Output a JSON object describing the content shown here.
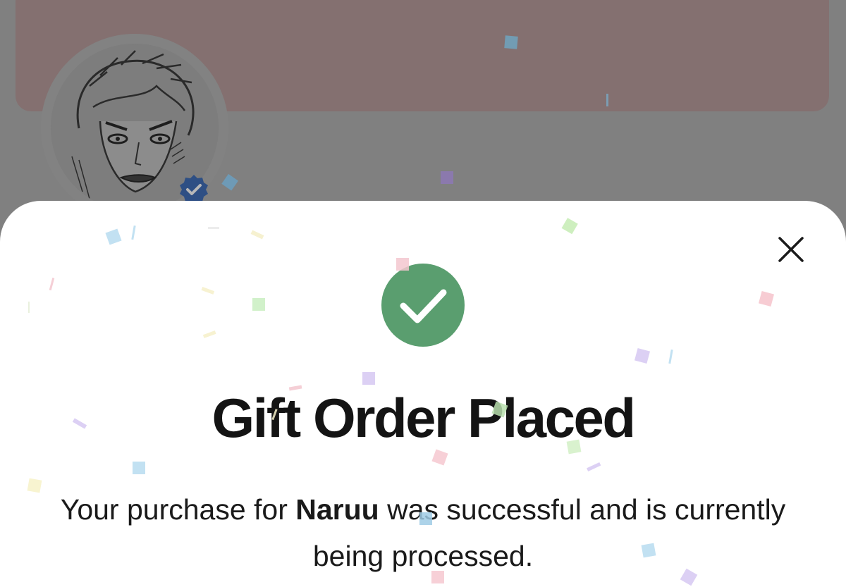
{
  "profile": {
    "avatar_label": "profile avatar",
    "verified_icon": "verified-badge-icon"
  },
  "modal": {
    "close_icon": "close-icon",
    "success_icon": "check-circle-icon",
    "title": "Gift Order Placed",
    "message_prefix": "Your purchase for ",
    "recipient": "Naruu",
    "message_suffix": " was successful and is currently being processed."
  },
  "colors": {
    "success": "#5A9E6F",
    "verified": "#2E4F84",
    "overlay": "#808080",
    "banner": "#847070"
  }
}
